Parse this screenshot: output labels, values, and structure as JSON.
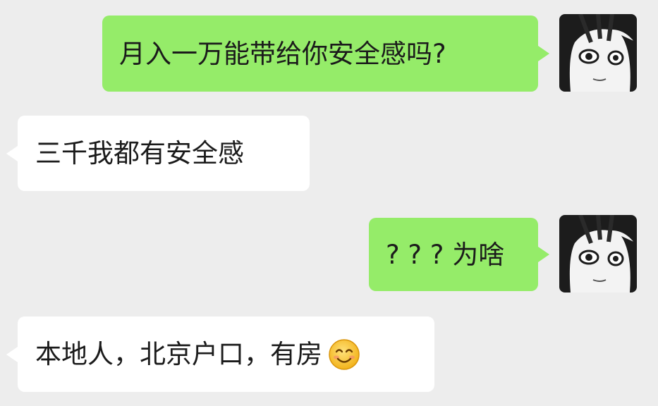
{
  "messages": [
    {
      "side": "outgoing",
      "text": "月入一万能带给你安全感吗?"
    },
    {
      "side": "incoming",
      "text": "三千我都有安全感"
    },
    {
      "side": "outgoing",
      "text": "? ? ? 为啥"
    },
    {
      "side": "incoming",
      "text": "本地人，北京户口，有房",
      "trailing_emoji": "smiling-face-emoji"
    }
  ],
  "colors": {
    "background": "#ededed",
    "outgoing_bubble": "#95ec69",
    "incoming_bubble": "#ffffff",
    "text": "#1b1b1b"
  },
  "icons": {
    "avatar": "anime-girl-avatar",
    "emoji": "smiling-face-emoji"
  }
}
